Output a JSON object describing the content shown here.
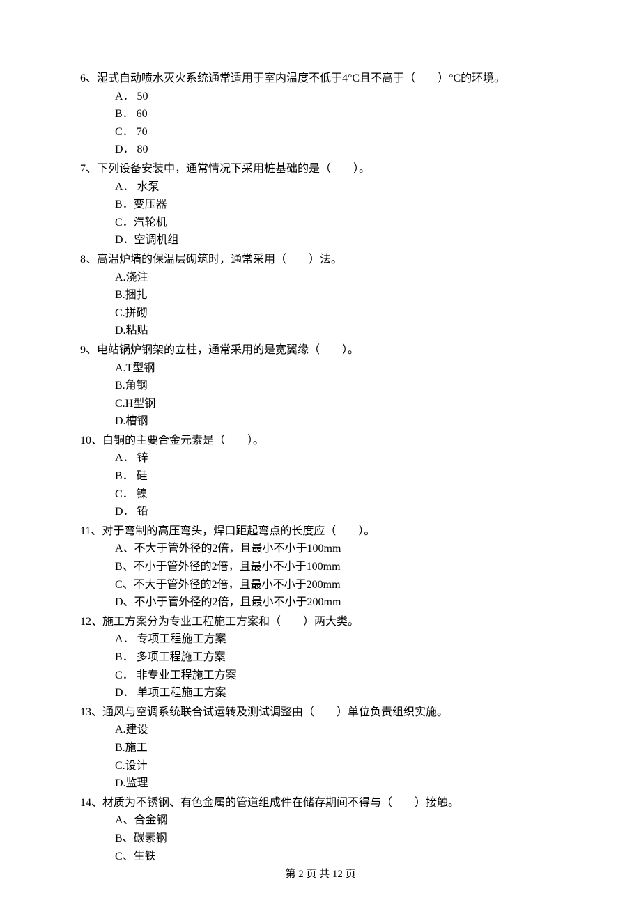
{
  "questions": [
    {
      "num": "6、",
      "text": "湿式自动喷水灭火系统通常适用于室内温度不低于4°C且不高于（　　）°C的环境。",
      "options": [
        "A． 50",
        "B． 60",
        "C． 70",
        "D． 80"
      ]
    },
    {
      "num": "7、",
      "text": "下列设备安装中，通常情况下采用桩基础的是（　　）。",
      "options": [
        "A． 水泵",
        "B．变压器",
        "C．汽轮机",
        "D．空调机组"
      ]
    },
    {
      "num": "8、",
      "text": "高温炉墙的保温层砌筑时，通常采用（　　）法。",
      "options": [
        "A.浇注",
        "B.捆扎",
        "C.拼砌",
        "D.粘贴"
      ]
    },
    {
      "num": "9、",
      "text": "电站锅炉钢架的立柱，通常采用的是宽翼缘（　　）。",
      "options": [
        "A.T型钢",
        "B.角钢",
        "C.H型钢",
        "D.槽钢"
      ]
    },
    {
      "num": "10、",
      "text": "白铜的主要合金元素是（　　）。",
      "options": [
        "A． 锌",
        "B． 硅",
        "C． 镍",
        "D． 铅"
      ]
    },
    {
      "num": "11、",
      "text": "对于弯制的高压弯头，焊口距起弯点的长度应（　　）。",
      "options": [
        "A、不大于管外径的2倍，且最小不小于100mm",
        "B、不小于管外径的2倍，且最小不小于100mm",
        "C、不大于管外径的2倍，且最小不小于200mm",
        "D、不小于管外径的2倍，且最小不小于200mm"
      ]
    },
    {
      "num": "12、",
      "text": "施工方案分为专业工程施工方案和（　　）两大类。",
      "options": [
        "A． 专项工程施工方案",
        "B． 多项工程施工方案",
        "C． 非专业工程施工方案",
        "D． 单项工程施工方案"
      ]
    },
    {
      "num": "13、",
      "text": "通风与空调系统联合试运转及测试调整由（　　）单位负责组织实施。",
      "options": [
        "A.建设",
        "B.施工",
        "C.设计",
        "D.监理"
      ]
    },
    {
      "num": "14、",
      "text": "材质为不锈钢、有色金属的管道组成件在储存期间不得与（　　）接触。",
      "options": [
        "A、合金钢",
        "B、碳素钢",
        "C、生铁"
      ]
    }
  ],
  "footer": "第 2 页 共 12 页"
}
